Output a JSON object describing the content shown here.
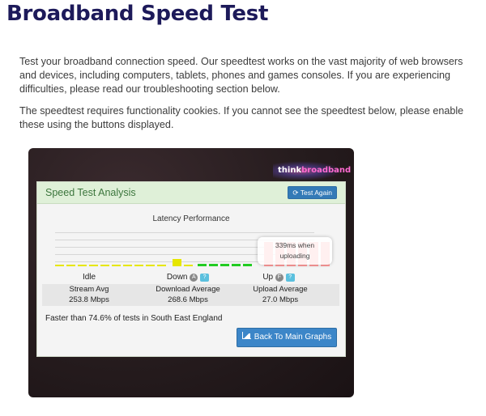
{
  "page": {
    "title": "Broadband Speed Test",
    "intro": "Test your broadband connection speed. Our speedtest works on the vast majority of web browsers and devices, including computers, tablets, phones and games consoles. If you are experiencing difficulties, please read our troubleshooting section below.",
    "cookie_note": "The speedtest requires functionality cookies. If you cannot see the speedtest below, please enable these using the buttons displayed."
  },
  "widget": {
    "logo": {
      "prefix": "think",
      "suffix": "broadband"
    },
    "panel_title": "Speed Test Analysis",
    "test_again_label": "Test Again",
    "latency_title": "Latency Performance",
    "latency_badge": {
      "line1": "339ms when",
      "line2": "uploading"
    },
    "columns": {
      "idle": "Idle",
      "down": "Down",
      "up": "Up",
      "down_icon": "A",
      "up_icon": "F",
      "help_icon": "?"
    },
    "stats": {
      "stream_label": "Stream Avg",
      "stream_value": "253.8 Mbps",
      "download_label": "Download Average",
      "download_value": "268.6 Mbps",
      "upload_label": "Upload Average",
      "upload_value": "27.0 Mbps"
    },
    "faster_text": "Faster than 74.6% of tests in South East England",
    "back_button_label": "Back To Main Graphs",
    "colors": {
      "idle": "#e6e600",
      "down": "#22cc22",
      "up": "#ff9999",
      "panel_head": "#dff0d8",
      "button": "#337ab7"
    }
  }
}
